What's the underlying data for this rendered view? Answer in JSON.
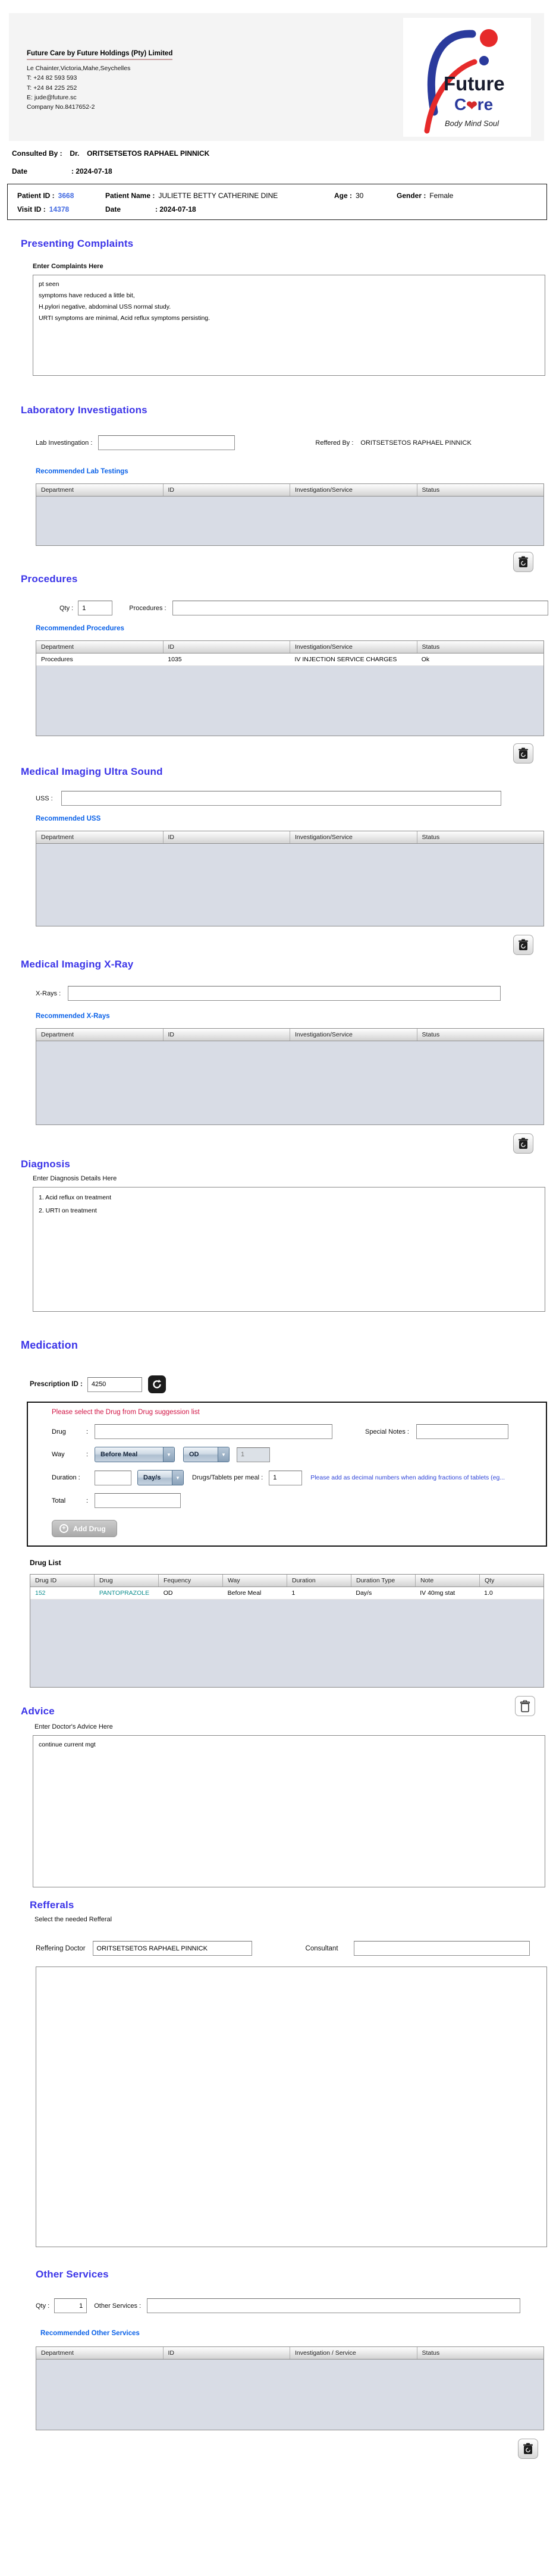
{
  "ui": {
    "colon": ":",
    "arrow": "▼",
    "plus": "+"
  },
  "header": {
    "company_title": "Future Care by Future Holdings (Pty) Limited",
    "address_lines": [
      "Le Chainter,Victoria,Mahe,Seychelles",
      "T: +24  82 593 593",
      "T: +24  84 225 252",
      "E: jude@future.sc",
      "Company No.8417652-2"
    ],
    "logo": {
      "name": "Future",
      "care_pre": "C",
      "care_heart": "❤",
      "care_post": "re",
      "tagline": "Body Mind Soul"
    }
  },
  "consult": {
    "consulted_by_label": "Consulted By :",
    "doctor_title": "Dr.",
    "doctor_name": "ORITSETSETOS RAPHAEL PINNICK",
    "date_label": "Date",
    "date_value": ": 2024-07-18"
  },
  "patient_box": {
    "patient_id_label": "Patient ID :",
    "patient_id": "3668",
    "patient_name_label": "Patient Name :",
    "patient_name": "JULIETTE BETTY CATHERINE DINE",
    "age_label": "Age :",
    "age": "30",
    "gender_label": "Gender :",
    "gender": "Female",
    "visit_id_label": "Visit ID :",
    "visit_id": "14378",
    "date_label": "Date",
    "date_value": ": 2024-07-18"
  },
  "complaints": {
    "title": "Presenting Complaints",
    "label": "Enter Complaints Here",
    "text": "pt seen\nsymptoms have reduced a little bit,\nH.pylori negative, abdominal USS normal study.\nURTI symptoms are minimal, Acid reflux symptoms persisting."
  },
  "lab": {
    "title": "Laboratory  Investigations",
    "input_label": "Lab Investingation :",
    "input_value": "",
    "referred_by_label": "Reffered By :",
    "referred_by": "ORITSETSETOS RAPHAEL PINNICK",
    "recommended_label": "Recommended Lab Testings",
    "headers": [
      "Department",
      "ID",
      "Investigation/Service",
      "Status"
    ]
  },
  "procedures": {
    "title": "Procedures",
    "qty_label": "Qty :",
    "qty_value": "1",
    "input_label": "Procedures :",
    "input_value": "",
    "recommended_label": "Recommended Procedures",
    "headers": [
      "Department",
      "ID",
      "Investigation/Service",
      "Status"
    ],
    "row": {
      "department": "Procedures",
      "id": "1035",
      "service": "IV INJECTION SERVICE CHARGES",
      "status": "Ok"
    }
  },
  "uss": {
    "title": "Medical Imaging Ultra Sound",
    "input_label": "USS :",
    "input_value": "",
    "recommended_label": "Recommended USS",
    "headers": [
      "Department",
      "ID",
      "Investigation/Service",
      "Status"
    ]
  },
  "xray": {
    "title": "Medical Imaging X-Ray",
    "input_label": "X-Rays :",
    "input_value": "",
    "recommended_label": "Recommended X-Rays",
    "headers": [
      "Department",
      "ID",
      "Investigation/Service",
      "Status"
    ]
  },
  "diagnosis": {
    "title": "Diagnosis",
    "label": "Enter Diagnosis Details Here",
    "text": "1. Acid reflux on treatment\n2. URTI on treatment"
  },
  "medication": {
    "title": "Medication",
    "prescription_label": "Prescription ID :",
    "prescription_id": "4250",
    "warning": "Please select the Drug from Drug suggession list",
    "drug_label": "Drug",
    "drug_value": "",
    "special_notes_label": "Special Notes :",
    "special_notes_value": "",
    "way_label": "Way",
    "way_meal": "Before Meal",
    "way_freq": "OD",
    "way_qty": "1",
    "duration_label": "Duration :",
    "duration_value": "",
    "duration_unit": "Day/s",
    "per_meal_label": "Drugs/Tablets per meal :",
    "per_meal_value": "1",
    "fraction_note": "Please add as decimal numbers when adding fractions of tablets (eg...",
    "total_label": "Total",
    "total_value": "",
    "add_drug_label": "Add Drug",
    "drug_list_label": "Drug List",
    "drug_headers": [
      "Drug ID",
      "Drug",
      "Fequency",
      "Way",
      "Duration",
      "Duration Type",
      "Note",
      "Qty"
    ],
    "drug_row": {
      "id": "152",
      "drug": "PANTOPRAZOLE",
      "frequency": "OD",
      "way": "Before Meal",
      "duration": "1",
      "duration_type": "Day/s",
      "note": "IV 40mg stat",
      "qty": "1.0"
    }
  },
  "advice": {
    "title": "Advice",
    "label": "Enter Doctor's Advice Here",
    "text": "continue current mgt"
  },
  "referrals": {
    "title": "Refferals",
    "subtitle": "Select the needed Refferal",
    "doctor_label": "Reffering Doctor",
    "doctor_value": "ORITSETSETOS RAPHAEL PINNICK",
    "consultant_label": "Consultant",
    "consultant_value": ""
  },
  "other_services": {
    "title": "Other Services",
    "qty_label": "Qty :",
    "qty_value": "1",
    "input_label": "Other Services :",
    "input_value": "",
    "recommended_label": "Recommended Other Services",
    "headers": [
      "Department",
      "ID",
      "Investigation / Service",
      "Status"
    ]
  }
}
